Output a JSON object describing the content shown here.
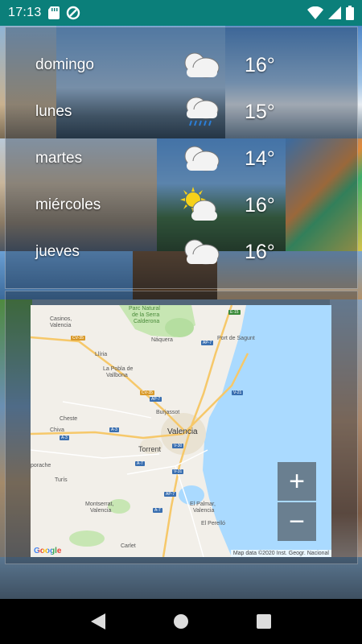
{
  "status_bar": {
    "time": "17:13",
    "icons": [
      "sd-card-icon",
      "data-saver-icon",
      "wifi-icon",
      "signal-icon",
      "battery-icon"
    ]
  },
  "forecast": [
    {
      "day": "domingo",
      "temp": "16°",
      "icon": "cloudy-icon"
    },
    {
      "day": "lunes",
      "temp": "15°",
      "icon": "rain-icon"
    },
    {
      "day": "martes",
      "temp": "14°",
      "icon": "cloudy-icon"
    },
    {
      "day": "miércoles",
      "temp": "16°",
      "icon": "partly-sunny-icon"
    },
    {
      "day": "jueves",
      "temp": "16°",
      "icon": "cloudy-icon"
    }
  ],
  "map": {
    "labels": {
      "parc_natural": "Parc Natural",
      "de_la_serra": "de la Serra",
      "calderona": "Calderona",
      "casinos": "Casinos,",
      "casinos_valencia": "Valencia",
      "naquera": "Náquera",
      "port_de_sagunt": "Port de Sagunt",
      "lliria": "Llíria",
      "la_pobla": "La Pobla de",
      "vallbona": "Vallbona",
      "burjassot": "Burjassot",
      "cheste": "Cheste",
      "chiva": "Chiva",
      "valencia": "Valencia",
      "torrent": "Torrent",
      "porache": "porache",
      "turis": "Turís",
      "montserrat": "Montserrat,",
      "montserrat_valencia": "Valencia",
      "el_palmar": "El Palmar,",
      "el_palmar_valencia": "Valencia",
      "el_perello": "El Perelló",
      "carlet": "Carlet"
    },
    "roads": {
      "cv35": "CV-35",
      "cv35b": "CV-35",
      "e15": "E-15",
      "ap7a": "AP-7",
      "ap7b": "AP-7",
      "ap7c": "AP-7",
      "ap7d": "AP-7",
      "v21": "V-21",
      "a3a": "A-3",
      "a3b": "A-3",
      "v30": "V-30",
      "v31": "V-31",
      "a7a": "A-7",
      "a7b": "A-7"
    },
    "attribution": "Map data ©2020 Inst. Geogr. Nacional",
    "google_logo": "Google",
    "zoom_in": "+",
    "zoom_out": "−"
  },
  "colors": {
    "status_bar": "#0b7f7a",
    "sea": "#aadaff",
    "land": "#f2efe9",
    "park": "#c7e6b3",
    "zoom_button": "#5f6e7d"
  }
}
